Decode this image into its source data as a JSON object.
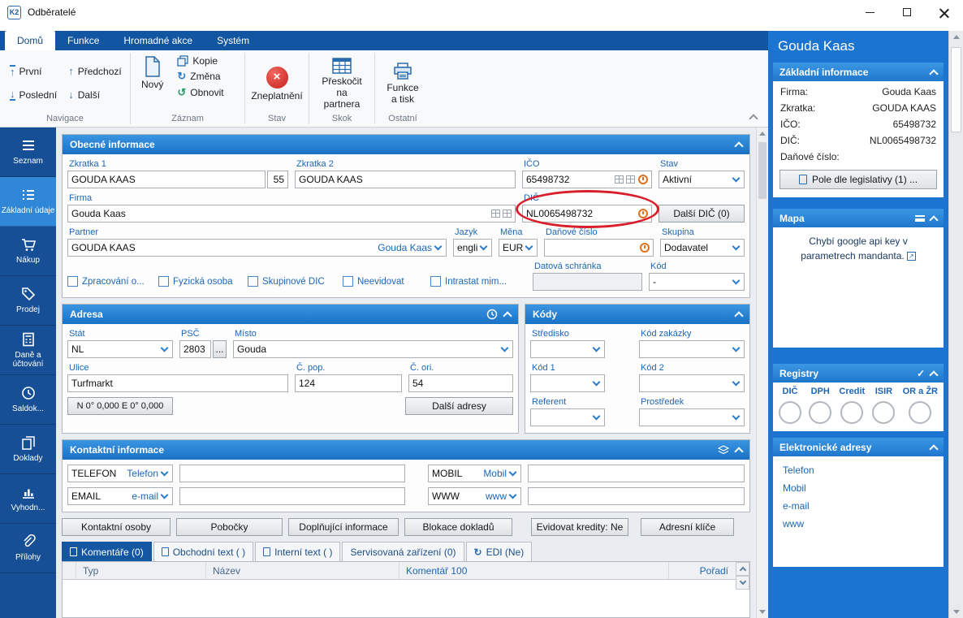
{
  "window": {
    "title": "Odběratelé",
    "badge": "K2"
  },
  "menu": {
    "tabs": [
      "Domů",
      "Funkce",
      "Hromadné akce",
      "Systém"
    ]
  },
  "ribbon": {
    "navigace_label": "Navigace",
    "zaznam_label": "Záznam",
    "stav_label": "Stav",
    "skok_label": "Skok",
    "ostatni_label": "Ostatní",
    "prvni": "První",
    "posledni": "Poslední",
    "predchozi": "Předchozí",
    "dalsi": "Další",
    "novy": "Nový",
    "kopie": "Kopie",
    "zmena": "Změna",
    "obnovit": "Obnovit",
    "zneplatneni": "Zneplatnění",
    "preskocit": "Přeskočit na partnera",
    "funkce_a_tisk": "Funkce a tisk"
  },
  "sidebar": {
    "items": [
      "Seznam",
      "Základní údaje",
      "Nákup",
      "Prodej",
      "Daně a účtování",
      "Saldok...",
      "Doklady",
      "Vyhodn...",
      "Přílohy"
    ]
  },
  "obecne": {
    "title": "Obecné informace",
    "zkratka1_label": "Zkratka 1",
    "zkratka1": "GOUDA KAAS",
    "zkratka1_poradi": "55",
    "zkratka2_label": "Zkratka 2",
    "zkratka2": "GOUDA KAAS",
    "ico_label": "IČO",
    "ico": "65498732",
    "stav_label": "Stav",
    "stav": "Aktivní",
    "firma_label": "Firma",
    "firma": "Gouda Kaas",
    "dic_label": "DIČ",
    "dic": "NL0065498732",
    "dalsi_dic": "Další DIČ (0)",
    "partner_label": "Partner",
    "partner": "GOUDA KAAS",
    "partner_link": "Gouda Kaas",
    "jazyk_label": "Jazyk",
    "jazyk": "english",
    "mena_label": "Měna",
    "mena": "EUR",
    "danove_cislo_label": "Daňové číslo",
    "danove_cislo": "",
    "skupina_label": "Skupina",
    "skupina": "Dodavatel",
    "chk1": "Zpracování o...",
    "chk2": "Fyzická osoba",
    "chk3": "Skupinové DIČ",
    "chk4": "Neevidovat",
    "chk5": "Intrastat mim...",
    "datova_schranka_label": "Datová schránka",
    "datova_schranka": "",
    "kod_label": "Kód",
    "kod": "-"
  },
  "adresa": {
    "title": "Adresa",
    "stat_label": "Stát",
    "stat": "NL",
    "psc_label": "PSČ",
    "psc": "2803",
    "psc_more": "...",
    "misto_label": "Místo",
    "misto": "Gouda",
    "ulice_label": "Ulice",
    "ulice": "Turfmarkt",
    "cpop_label": "Č. pop.",
    "cpop": "124",
    "cori_label": "Č. ori.",
    "cori": "54",
    "gps": "N 0° 0,000 E 0° 0,000",
    "dalsi_adresy": "Další adresy"
  },
  "kody": {
    "title": "Kódy",
    "stredisko_label": "Středisko",
    "kod_zakazky_label": "Kód zakázky",
    "kod1_label": "Kód 1",
    "kod2_label": "Kód 2",
    "referent_label": "Referent",
    "prostredek_label": "Prostředek"
  },
  "kontakty": {
    "title": "Kontaktní informace",
    "telefon_typ": "TELEFON",
    "telefon_sel": "Telefon",
    "mobil_typ": "MOBIL",
    "mobil_sel": "Mobil",
    "email_typ": "EMAIL",
    "email_sel": "e-mail",
    "www_typ": "WWW",
    "www_sel": "www"
  },
  "akce": {
    "kontaktni_osoby": "Kontaktní osoby",
    "pobocky": "Pobočky",
    "doplnujici": "Doplňující informace",
    "blokace": "Blokace dokladů",
    "kredity": "Evidovat kredity: Ne",
    "adresni_klice": "Adresní klíče"
  },
  "tabs": {
    "komentare": "Komentáře (0)",
    "obchodni": "Obchodní text ( )",
    "interni": "Interní text ( )",
    "servisovana": "Servisovaná zařízení (0)",
    "edi": "EDI (Ne)"
  },
  "tabulka": {
    "col_typ": "Typ",
    "col_nazev": "Název",
    "col_komentar": "Komentář 100",
    "col_poradi": "Pořadí"
  },
  "panel": {
    "title": "Gouda Kaas",
    "zakladni_title": "Základní informace",
    "firma_label": "Firma:",
    "firma": "Gouda Kaas",
    "zkratka_label": "Zkratka:",
    "zkratka": "GOUDA KAAS",
    "ico_label": "IČO:",
    "ico": "65498732",
    "dic_label": "DIČ:",
    "dic": "NL0065498732",
    "danove_label": "Daňové číslo:",
    "danove": "",
    "legislativa": "Pole dle legislativy (1) ...",
    "mapa_title": "Mapa",
    "mapa_text": "Chybí google api key v parametrech mandanta.",
    "registry_title": "Registry",
    "reg1": "DIČ",
    "reg2": "DPH",
    "reg3": "Credit",
    "reg4": "ISIR",
    "reg5": "OR a ŽR",
    "adresy_title": "Elektronické adresy",
    "adr1": "Telefon",
    "adr2": "Mobil",
    "adr3": "e-mail",
    "adr4": "www"
  }
}
